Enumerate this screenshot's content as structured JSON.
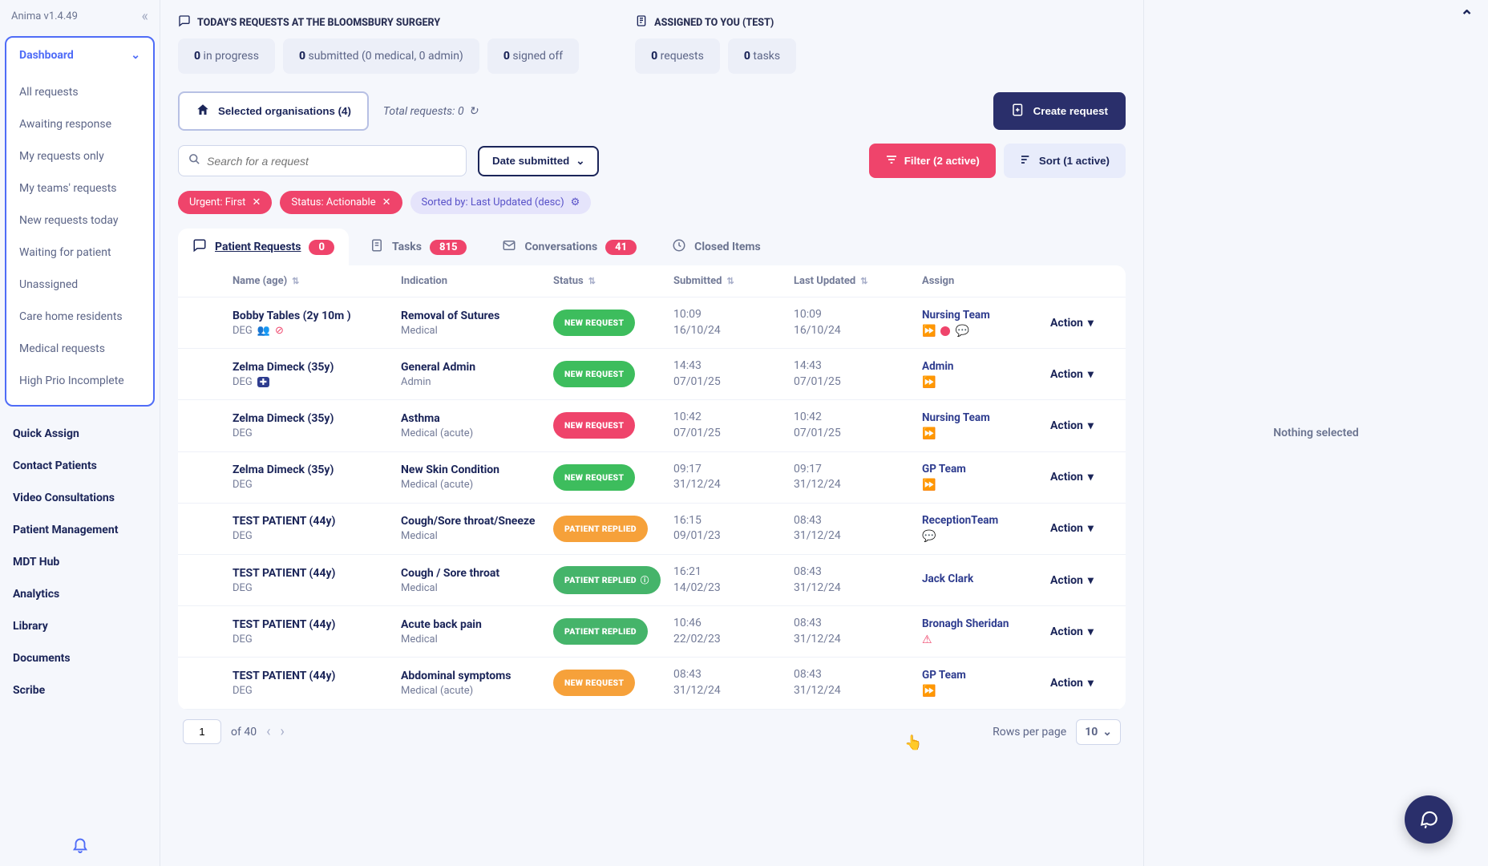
{
  "app": {
    "version_label": "Anima v1.4.49"
  },
  "sidebar": {
    "header": "Dashboard",
    "items": [
      "All requests",
      "Awaiting response",
      "My requests only",
      "My teams' requests",
      "New requests today",
      "Waiting for patient",
      "Unassigned",
      "Care home residents",
      "Medical requests",
      "High Prio Incomplete"
    ],
    "extras": [
      "Quick Assign",
      "Contact Patients",
      "Video Consultations",
      "Patient Management",
      "MDT Hub",
      "Analytics",
      "Library",
      "Documents",
      "Scribe"
    ]
  },
  "summary": {
    "left_title": "TODAY'S REQUESTS AT THE BLOOMSBURY SURGERY",
    "right_title": "ASSIGNED TO YOU (TEST)",
    "left_cards": [
      {
        "bold": "0",
        "text": " in progress"
      },
      {
        "bold": "0",
        "text": " submitted (0 medical, 0 admin)"
      },
      {
        "bold": "0",
        "text": " signed off"
      }
    ],
    "right_cards": [
      {
        "bold": "0",
        "text": " requests"
      },
      {
        "bold": "0",
        "text": " tasks"
      }
    ]
  },
  "controls": {
    "org_label": "Selected organisations (4)",
    "total_label": "Total requests: 0",
    "create_label": "Create request",
    "search_placeholder": "Search for a request",
    "date_label": "Date submitted",
    "filter_label": "Filter (2 active)",
    "sort_label": "Sort (1 active)"
  },
  "chips": {
    "urgent": "Urgent: First",
    "status": "Status: Actionable",
    "sorted_by": "Sorted by: Last Updated (desc)"
  },
  "tabs": {
    "patient": {
      "label": "Patient Requests",
      "count": "0"
    },
    "tasks": {
      "label": "Tasks",
      "count": "815"
    },
    "conv": {
      "label": "Conversations",
      "count": "41"
    },
    "closed": {
      "label": "Closed Items"
    }
  },
  "columns": {
    "name": "Name (age)",
    "indication": "Indication",
    "status": "Status",
    "submitted": "Submitted",
    "last_updated": "Last Updated",
    "assign": "Assign"
  },
  "rows": [
    {
      "name": "Bobby Tables (2y 10m )",
      "org": "DEG",
      "name_icons": [
        "people",
        "badge"
      ],
      "indication": "Removal of Sutures",
      "ind_sub": "Medical",
      "status": "NEW REQUEST",
      "status_class": "sp-green",
      "submitted_t": "10:09",
      "submitted_d": "16/10/24",
      "updated_t": "10:09",
      "updated_d": "16/10/24",
      "assign": "Nursing Team",
      "assign_icons": [
        "fwd",
        "reddot",
        "chat"
      ]
    },
    {
      "name": "Zelma Dimeck (35y)",
      "org": "DEG",
      "name_icons": [
        "plus"
      ],
      "indication": "General Admin",
      "ind_sub": "Admin",
      "status": "NEW REQUEST",
      "status_class": "sp-green",
      "submitted_t": "14:43",
      "submitted_d": "07/01/25",
      "updated_t": "14:43",
      "updated_d": "07/01/25",
      "assign": "Admin",
      "assign_icons": [
        "fwd"
      ]
    },
    {
      "name": "Zelma Dimeck (35y)",
      "org": "DEG",
      "name_icons": [],
      "indication": "Asthma",
      "ind_sub": "Medical (acute)",
      "status": "NEW REQUEST",
      "status_class": "sp-red",
      "submitted_t": "10:42",
      "submitted_d": "07/01/25",
      "updated_t": "10:42",
      "updated_d": "07/01/25",
      "assign": "Nursing Team",
      "assign_icons": [
        "fwd"
      ]
    },
    {
      "name": "Zelma Dimeck (35y)",
      "org": "DEG",
      "name_icons": [],
      "indication": "New Skin Condition",
      "ind_sub": "Medical (acute)",
      "status": "NEW REQUEST",
      "status_class": "sp-green",
      "submitted_t": "09:17",
      "submitted_d": "31/12/24",
      "updated_t": "09:17",
      "updated_d": "31/12/24",
      "assign": "GP Team",
      "assign_icons": [
        "fwd"
      ]
    },
    {
      "name": "TEST PATIENT (44y)",
      "org": "DEG",
      "name_icons": [],
      "indication": "Cough/Sore throat/Sneeze",
      "ind_sub": "Medical",
      "status": "PATIENT REPLIED",
      "status_class": "sp-orange",
      "submitted_t": "16:15",
      "submitted_d": "09/01/23",
      "updated_t": "08:43",
      "updated_d": "31/12/24",
      "assign": "ReceptionTeam",
      "assign_icons": [
        "chat"
      ]
    },
    {
      "name": "TEST PATIENT (44y)",
      "org": "DEG",
      "name_icons": [],
      "indication": "Cough / Sore throat",
      "ind_sub": "Medical",
      "status": "PATIENT REPLIED",
      "status_class": "sp-greenalt",
      "status_extra": "info",
      "submitted_t": "16:21",
      "submitted_d": "14/02/23",
      "updated_t": "08:43",
      "updated_d": "31/12/24",
      "assign": "Jack Clark",
      "assign_icons": []
    },
    {
      "name": "TEST PATIENT (44y)",
      "org": "DEG",
      "name_icons": [],
      "indication": "Acute back pain",
      "ind_sub": "Medical",
      "status": "PATIENT REPLIED",
      "status_class": "sp-greenalt",
      "submitted_t": "10:46",
      "submitted_d": "22/02/23",
      "updated_t": "08:43",
      "updated_d": "31/12/24",
      "assign": "Bronagh Sheridan",
      "assign_icons": [
        "warn"
      ]
    },
    {
      "name": "TEST PATIENT (44y)",
      "org": "DEG",
      "name_icons": [],
      "indication": "Abdominal symptoms",
      "ind_sub": "Medical (acute)",
      "status": "NEW REQUEST",
      "status_class": "sp-orange",
      "submitted_t": "08:43",
      "submitted_d": "31/12/24",
      "updated_t": "08:43",
      "updated_d": "31/12/24",
      "assign": "GP Team",
      "assign_icons": [
        "fwd"
      ]
    }
  ],
  "action_label": "Action",
  "paginator": {
    "page": "1",
    "of": "of 40",
    "rows_label": "Rows per page",
    "rows_value": "10"
  },
  "right_panel": {
    "empty": "Nothing selected"
  }
}
